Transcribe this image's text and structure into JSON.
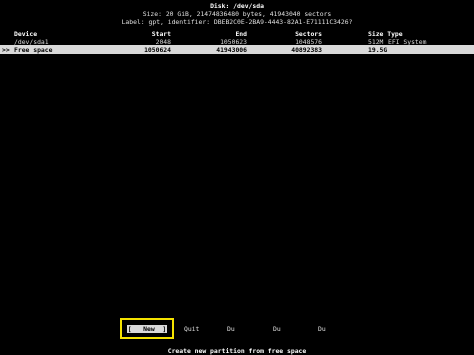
{
  "disk": {
    "title": "Disk: /dev/sda",
    "size_line": "Size: 20 GiB, 21474836480 bytes, 41943040 sectors",
    "label_line": "Label: gpt, identifier: DBEB2C0E-2BA9-4443-82A1-E71111C3426?"
  },
  "table": {
    "headers": {
      "device": "Device",
      "start": "Start",
      "end": "End",
      "sectors": "Sectors",
      "size_type": "Size Type"
    },
    "rows": [
      {
        "marker": "",
        "device": "/dev/sda1",
        "start": "2048",
        "end": "1050623",
        "sectors": "1048576",
        "size": "512M",
        "type": "EFI System"
      },
      {
        "marker": ">>",
        "device": "Free space",
        "start": "1050624",
        "end": "41943006",
        "sectors": "40892383",
        "size": "19.5G",
        "type": ""
      }
    ]
  },
  "menu": {
    "items": [
      "[   New  ]",
      "Quit",
      "Du",
      "Du",
      "Du"
    ]
  },
  "status": "Create new partition from free space",
  "colors": {
    "background": "#000000",
    "highlight": "#d9d9d9",
    "focus_border": "#f5e300"
  }
}
